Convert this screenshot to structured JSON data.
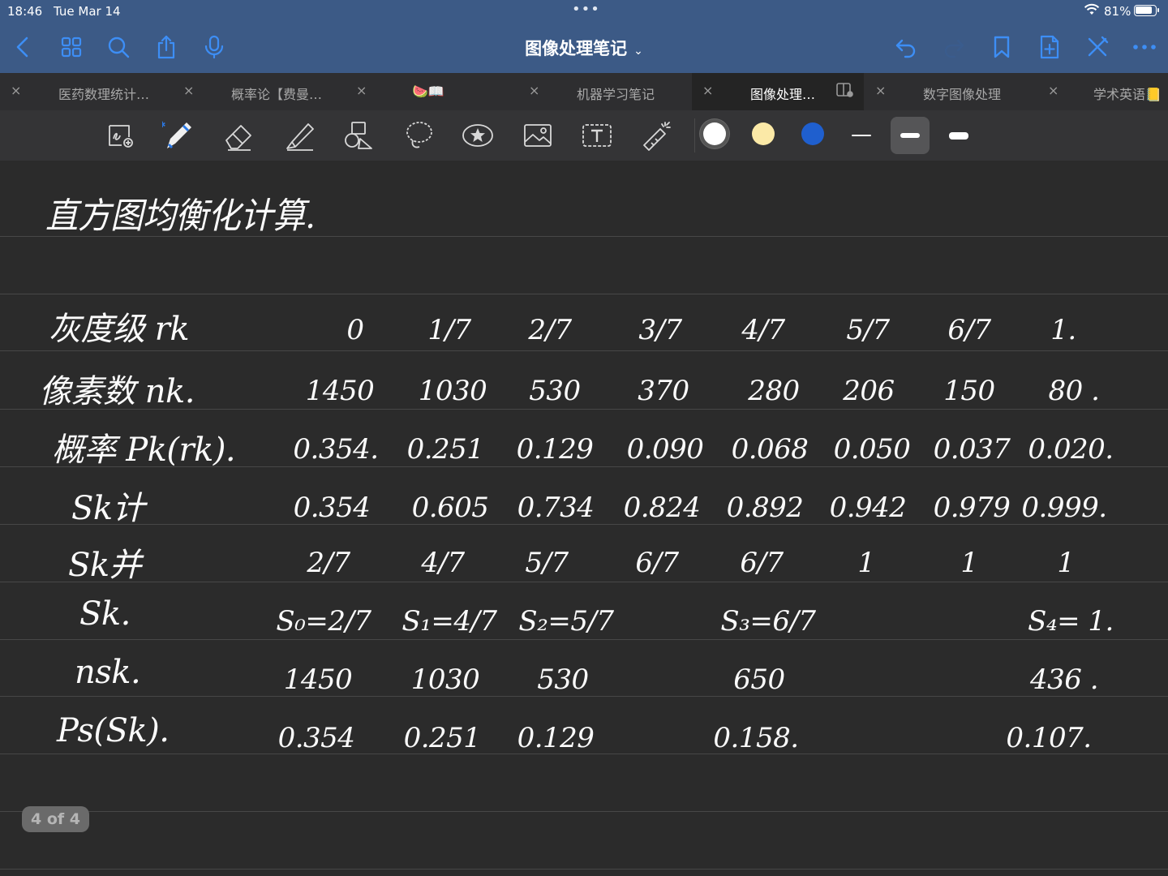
{
  "status_bar": {
    "time": "18:46",
    "date": "Tue Mar 14",
    "battery": "81%"
  },
  "nav": {
    "title": "图像处理笔记"
  },
  "tabs": [
    {
      "label": "医药数理统计…",
      "close": "×",
      "active": false
    },
    {
      "label": "概率论【费曼…",
      "close": "×",
      "active": false
    },
    {
      "label": "🍉📖",
      "close": "×",
      "active": false
    },
    {
      "label": "机器学习笔记",
      "close": "×",
      "active": false
    },
    {
      "label": "图像处理…",
      "close": "×",
      "active": true
    },
    {
      "label": "数字图像处理",
      "close": "×",
      "active": false
    },
    {
      "label": "学术英语📒",
      "close": "×",
      "active": false
    }
  ],
  "toolbar": {
    "colors": [
      "#ffffff",
      "#fbe9a7",
      "#1f5fce"
    ],
    "selected_color": "#ffffff",
    "selected_tool": "pen",
    "selected_stroke": "medium"
  },
  "note": {
    "title": "直方图均衡化计算.",
    "rows": [
      {
        "label": "灰度级 rk",
        "cells": [
          "0",
          "1/7",
          "2/7",
          "3/7",
          "4/7",
          "5/7",
          "6/7",
          "1."
        ]
      },
      {
        "label": "像素数 nk.",
        "cells": [
          "1450",
          "1030",
          "530",
          "370",
          "280",
          "206",
          "150",
          "80 ."
        ]
      },
      {
        "label": "概率 Pk(rk).",
        "cells": [
          "0.354.",
          "0.251",
          "0.129",
          "0.090",
          "0.068",
          "0.050",
          "0.037",
          "0.020."
        ]
      },
      {
        "label": "Sk计",
        "cells": [
          "0.354",
          "0.605",
          "0.734",
          "0.824",
          "0.892",
          "0.942",
          "0.979",
          "0.999."
        ]
      },
      {
        "label": "Sk并",
        "cells": [
          "2/7",
          "4/7",
          "5/7",
          "6/7",
          "6/7",
          "1",
          "1",
          "1"
        ]
      },
      {
        "label": "Sk.",
        "cells": [
          "S₀=2/7",
          "S₁=4/7",
          "S₂=5/7",
          "",
          "S₃=6/7",
          "",
          "",
          "S₄= 1."
        ]
      },
      {
        "label": "nsk.",
        "cells": [
          "1450",
          "1030",
          "530",
          "",
          "650",
          "",
          "",
          "436 ."
        ]
      },
      {
        "label": "Ps(Sk).",
        "cells": [
          "0.354",
          "0.251",
          "0.129",
          "",
          "0.158.",
          "",
          "",
          "0.107."
        ]
      }
    ]
  },
  "page_indicator": "4 of 4"
}
